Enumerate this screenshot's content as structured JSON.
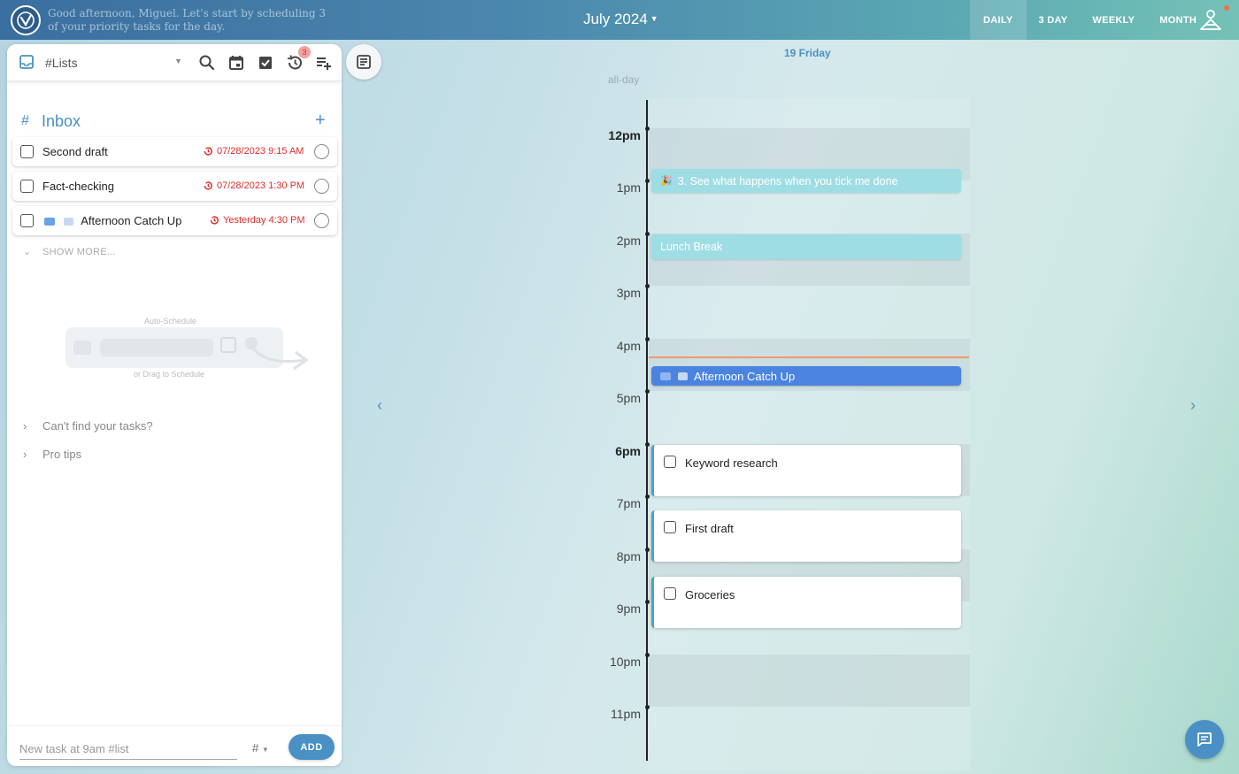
{
  "header": {
    "greeting": "Good afternoon, Miguel. Let's start by scheduling 3 of your priority tasks for the day.",
    "month_title": "July 2024",
    "views": [
      "DAILY",
      "3 DAY",
      "WEEKLY",
      "MONTH"
    ],
    "active_view": "DAILY"
  },
  "sidebar": {
    "list_selector": "#Lists",
    "history_badge": "3",
    "inbox_title": "Inbox",
    "tasks": [
      {
        "title": "Second draft",
        "due": "07/28/2023 9:15 AM"
      },
      {
        "title": "Fact-checking",
        "due": "07/28/2023 1:30 PM"
      },
      {
        "title": "Afternoon Catch Up",
        "due": "Yesterday 4:30 PM"
      }
    ],
    "show_more": "SHOW MORE...",
    "illustration": {
      "auto": "Auto-Schedule",
      "drag": "or Drag to Schedule"
    },
    "help": [
      "Can't find your tasks?",
      "Pro tips"
    ],
    "new_task_placeholder": "New task at 9am #list",
    "hash_select": "#",
    "add_label": "ADD"
  },
  "calendar": {
    "day_label": "19 Friday",
    "allday_label": "all-day",
    "hours": [
      "12pm",
      "1pm",
      "2pm",
      "3pm",
      "4pm",
      "5pm",
      "6pm",
      "7pm",
      "8pm",
      "9pm",
      "10pm",
      "11pm"
    ],
    "events": [
      {
        "title": "3. See what happens when you tick me done",
        "emoji": "🎉"
      },
      {
        "title": "Lunch Break"
      },
      {
        "title": "Afternoon Catch Up"
      }
    ],
    "task_events": [
      "Keyword research",
      "First draft",
      "Groceries"
    ]
  },
  "colors": {
    "accent": "#4a90c4",
    "overdue": "#e02b2b",
    "event_cyan": "#9fdde4",
    "event_blue": "#4a83e0",
    "now_line": "#f0986a"
  }
}
